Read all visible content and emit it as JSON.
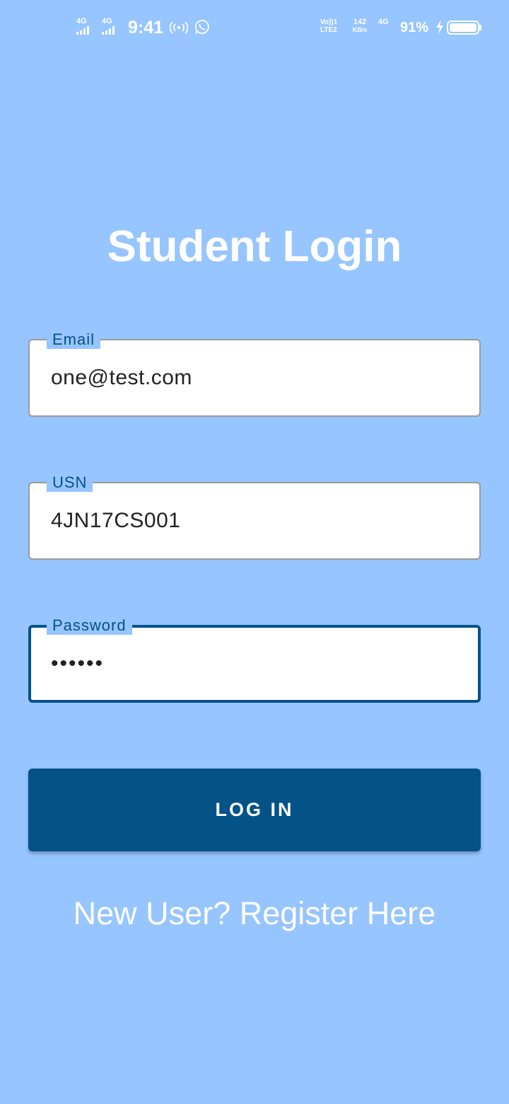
{
  "status_bar": {
    "sim1_network": "4G",
    "sim2_network": "4G",
    "time": "9:41",
    "volte_top": "Vo))1",
    "volte_bottom": "LTE2",
    "speed_value": "142",
    "speed_unit": "KB/s",
    "data_network": "4G",
    "battery_percent": "91%",
    "icons": [
      "signal-icon",
      "hotspot-icon",
      "whatsapp-icon",
      "charging-bolt-icon",
      "battery-icon"
    ]
  },
  "page": {
    "title": "Student Login"
  },
  "form": {
    "email": {
      "label": "Email",
      "value": "one@test.com"
    },
    "usn": {
      "label": "USN",
      "value": "4JN17CS001"
    },
    "password": {
      "label": "Password",
      "value": "••••••"
    }
  },
  "actions": {
    "login_label": "LOG IN",
    "register_label": "New User? Register Here"
  },
  "colors": {
    "background": "#96c5ff",
    "primary": "#045287",
    "field_background": "#ffffff",
    "text_light": "#ffffff"
  }
}
